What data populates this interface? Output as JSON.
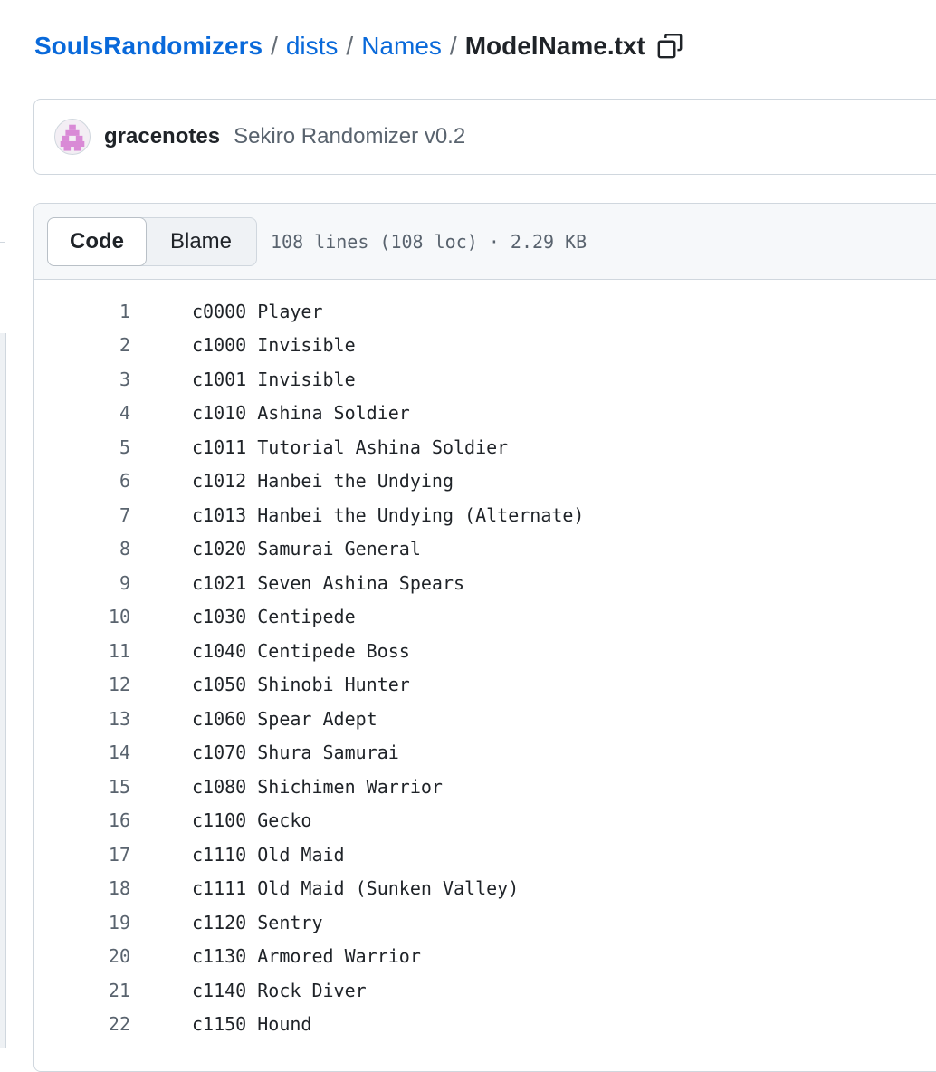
{
  "breadcrumb": {
    "repo": "SoulsRandomizers",
    "sep": "/",
    "folder1": "dists",
    "folder2": "Names",
    "file": "ModelName.txt"
  },
  "commit": {
    "author": "gracenotes",
    "message": "Sekiro Randomizer v0.2"
  },
  "file_header": {
    "code_tab": "Code",
    "blame_tab": "Blame",
    "info": "108 lines (108 loc) · 2.29 KB"
  },
  "icons": {
    "copy": "copy-icon",
    "avatar": "identicon-avatar"
  },
  "colors": {
    "link": "#0969da",
    "avatar_pink": "#d98ad6"
  },
  "lines": [
    {
      "n": "1",
      "text": "c0000 Player"
    },
    {
      "n": "2",
      "text": "c1000 Invisible"
    },
    {
      "n": "3",
      "text": "c1001 Invisible"
    },
    {
      "n": "4",
      "text": "c1010 Ashina Soldier"
    },
    {
      "n": "5",
      "text": "c1011 Tutorial Ashina Soldier"
    },
    {
      "n": "6",
      "text": "c1012 Hanbei the Undying"
    },
    {
      "n": "7",
      "text": "c1013 Hanbei the Undying (Alternate)"
    },
    {
      "n": "8",
      "text": "c1020 Samurai General"
    },
    {
      "n": "9",
      "text": "c1021 Seven Ashina Spears"
    },
    {
      "n": "10",
      "text": "c1030 Centipede"
    },
    {
      "n": "11",
      "text": "c1040 Centipede Boss"
    },
    {
      "n": "12",
      "text": "c1050 Shinobi Hunter"
    },
    {
      "n": "13",
      "text": "c1060 Spear Adept"
    },
    {
      "n": "14",
      "text": "c1070 Shura Samurai"
    },
    {
      "n": "15",
      "text": "c1080 Shichimen Warrior"
    },
    {
      "n": "16",
      "text": "c1100 Gecko"
    },
    {
      "n": "17",
      "text": "c1110 Old Maid"
    },
    {
      "n": "18",
      "text": "c1111 Old Maid (Sunken Valley)"
    },
    {
      "n": "19",
      "text": "c1120 Sentry"
    },
    {
      "n": "20",
      "text": "c1130 Armored Warrior"
    },
    {
      "n": "21",
      "text": "c1140 Rock Diver"
    },
    {
      "n": "22",
      "text": "c1150 Hound"
    }
  ]
}
